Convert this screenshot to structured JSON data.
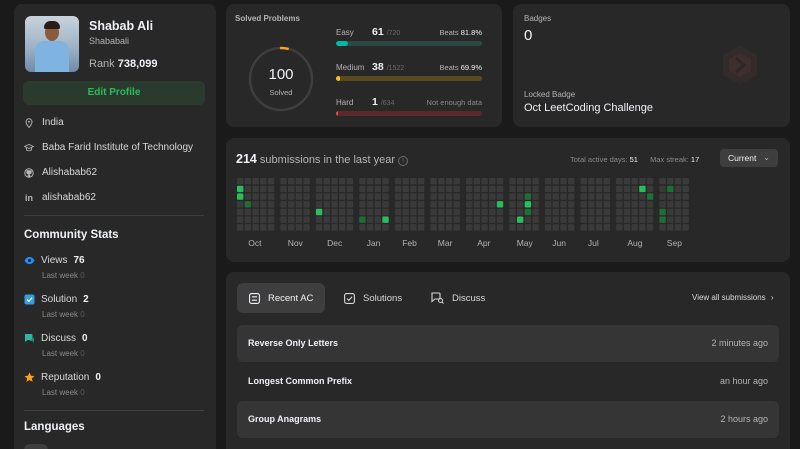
{
  "profile": {
    "name": "Shabab Ali",
    "username": "Shababali",
    "rank_label": "Rank",
    "rank": "738,099",
    "edit_label": "Edit Profile",
    "country": "India",
    "institute": "Baba Farid Institute of Technology",
    "github": "Alishabab62",
    "linkedin": "alishabab62"
  },
  "community": {
    "title": "Community Stats",
    "stats": [
      {
        "label": "Views",
        "value": "76",
        "sub": "Last week",
        "delta": "0",
        "icon": "eye-icon",
        "color": "#1e90ff"
      },
      {
        "label": "Solution",
        "value": "2",
        "sub": "Last week",
        "delta": "0",
        "icon": "solution-icon",
        "color": "#35a0d8"
      },
      {
        "label": "Discuss",
        "value": "0",
        "sub": "Last week",
        "delta": "0",
        "icon": "discuss-icon",
        "color": "#2fb5a0"
      },
      {
        "label": "Reputation",
        "value": "0",
        "sub": "Last week",
        "delta": "0",
        "icon": "star-icon",
        "color": "#ffa116"
      }
    ]
  },
  "languages": {
    "title": "Languages"
  },
  "solved": {
    "title": "Solved Problems",
    "total": "100",
    "total_label": "Solved",
    "difficulties": [
      {
        "name": "Easy",
        "count": "61",
        "total": "/720",
        "beats_label": "Beats",
        "beats": "81.8%",
        "fraction": 0.085,
        "color": "#00b8a3",
        "track": "#2b4a44"
      },
      {
        "name": "Medium",
        "count": "38",
        "total": "/1522",
        "beats_label": "Beats",
        "beats": "69.9%",
        "fraction": 0.025,
        "color": "#ffc01e",
        "track": "#5a4a1e"
      },
      {
        "name": "Hard",
        "count": "1",
        "total": "/634",
        "beats_label": "",
        "beats": "Not enough data",
        "fraction": 0.0016,
        "color": "#ef4743",
        "track": "#5a2a2a"
      }
    ]
  },
  "badges": {
    "title": "Badges",
    "count": "0",
    "locked_label": "Locked Badge",
    "locked_name": "Oct LeetCoding Challenge"
  },
  "calendar": {
    "count": "214",
    "title_rest": " submissions in the last year",
    "active_label": "Total active days:",
    "active_days": "51",
    "streak_label": "Max streak:",
    "max_streak": "17",
    "range_label": "Current",
    "months": [
      "Oct",
      "Nov",
      "Dec",
      "Jan",
      "Feb",
      "Mar",
      "Apr",
      "May",
      "Jun",
      "Jul",
      "Aug",
      "Sep"
    ]
  },
  "recent": {
    "tabs": [
      {
        "label": "Recent AC",
        "icon": "list-icon"
      },
      {
        "label": "Solutions",
        "icon": "checkbox-icon"
      },
      {
        "label": "Discuss",
        "icon": "discuss-icon"
      }
    ],
    "view_all": "View all submissions",
    "items": [
      {
        "title": "Reverse Only Letters",
        "time": "2 minutes ago"
      },
      {
        "title": "Longest Common Prefix",
        "time": "an hour ago"
      },
      {
        "title": "Group Anagrams",
        "time": "2 hours ago"
      }
    ]
  }
}
